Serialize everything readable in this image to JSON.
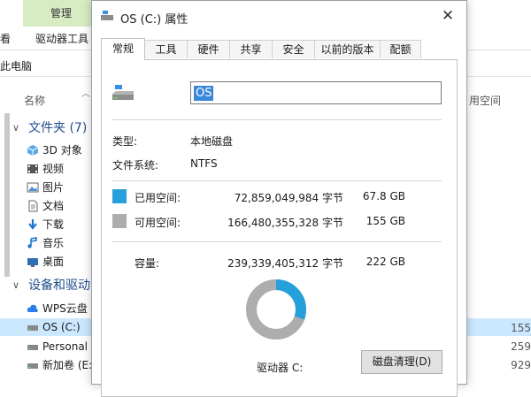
{
  "explorer": {
    "ribbon_manage_tab": "管理",
    "ribbon_left_tab": "看",
    "ribbon_drive_tools": "驱动器工具",
    "address": "此电脑",
    "column_name": "名称",
    "column_free": "用空间",
    "folders_group": "文件夹 (7)",
    "folders": [
      {
        "label": "3D 对象",
        "icon": "3d-objects-icon"
      },
      {
        "label": "视频",
        "icon": "video-icon"
      },
      {
        "label": "图片",
        "icon": "pictures-icon"
      },
      {
        "label": "文档",
        "icon": "documents-icon"
      },
      {
        "label": "下载",
        "icon": "download-icon"
      },
      {
        "label": "音乐",
        "icon": "music-icon"
      },
      {
        "label": "桌面",
        "icon": "desktop-icon"
      }
    ],
    "devices_group": "设备和驱动",
    "devices": [
      {
        "label": "WPS云盘",
        "icon": "cloud-icon"
      },
      {
        "label": "OS (C:)",
        "icon": "drive-icon"
      },
      {
        "label": "Personal",
        "icon": "drive-icon"
      },
      {
        "label": "新加卷 (E:",
        "icon": "drive-icon"
      }
    ],
    "right_values": [
      "155",
      "259",
      "929"
    ]
  },
  "dialog": {
    "title": "OS (C:) 属性",
    "close_glyph": "✕",
    "tabs": [
      "常规",
      "工具",
      "硬件",
      "共享",
      "安全",
      "以前的版本",
      "配额"
    ],
    "active_tab": "常规",
    "drive_name": "OS",
    "type_label": "类型:",
    "type_value": "本地磁盘",
    "fs_label": "文件系统:",
    "fs_value": "NTFS",
    "used_label": "已用空间:",
    "used_bytes": "72,859,049,984 字节",
    "used_size": "67.8 GB",
    "free_label": "可用空间:",
    "free_bytes": "166,480,355,328 字节",
    "free_size": "155 GB",
    "capacity_label": "容量:",
    "capacity_bytes": "239,339,405,312 字节",
    "capacity_size": "222 GB",
    "drive_label": "驱动器 C:",
    "cleanup_label": "磁盘清理(D)",
    "used_fraction": 0.3044,
    "colors": {
      "used": "#26a0da",
      "free": "#adadad"
    }
  }
}
